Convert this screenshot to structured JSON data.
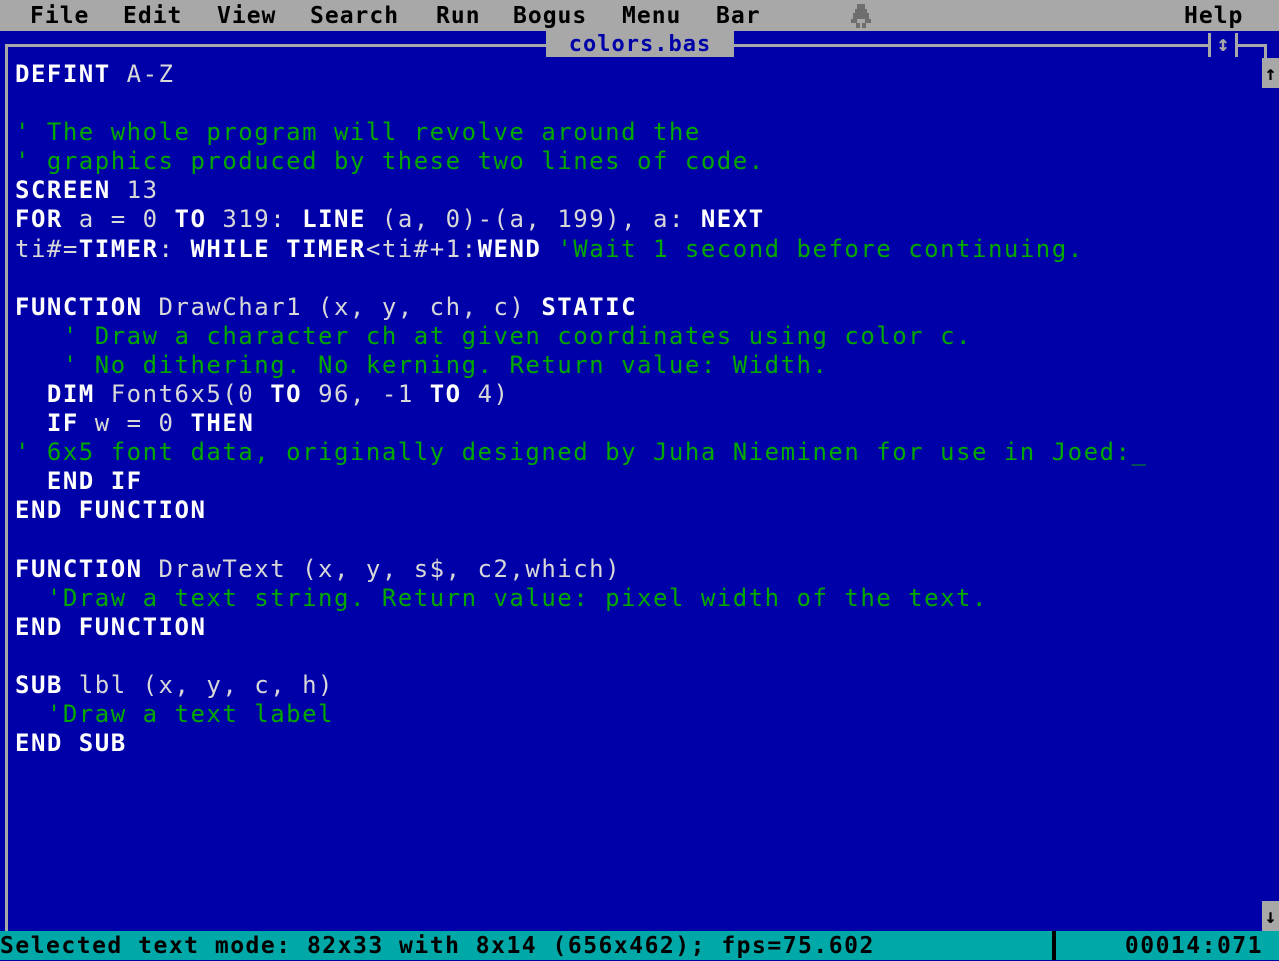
{
  "menubar": {
    "items": [
      "File",
      "Edit",
      "View",
      "Search",
      "Run",
      "Bogus",
      "Menu",
      "Bar"
    ],
    "help": "Help",
    "sprite_icon": "bug-sprite-icon"
  },
  "window": {
    "title": "colors.bas",
    "maximize_glyph": "↕"
  },
  "scrollbar": {
    "up_glyph": "↑",
    "down_glyph": "↓"
  },
  "code_lines": [
    [
      {
        "t": "kw",
        "s": "DEFINT"
      },
      {
        "t": "tx",
        "s": " A-Z"
      }
    ],
    [],
    [
      {
        "t": "cm",
        "s": "' The whole program will revolve around the"
      }
    ],
    [
      {
        "t": "cm",
        "s": "' graphics produced by these two lines of code."
      }
    ],
    [
      {
        "t": "kw",
        "s": "SCREEN"
      },
      {
        "t": "tx",
        "s": " 13"
      }
    ],
    [
      {
        "t": "kw",
        "s": "FOR"
      },
      {
        "t": "tx",
        "s": " a = 0 "
      },
      {
        "t": "kw",
        "s": "TO"
      },
      {
        "t": "tx",
        "s": " 319: "
      },
      {
        "t": "kw",
        "s": "LINE"
      },
      {
        "t": "tx",
        "s": " (a, 0)-(a, 199), a: "
      },
      {
        "t": "kw",
        "s": "NEXT"
      }
    ],
    [
      {
        "t": "tx",
        "s": "ti#="
      },
      {
        "t": "kw",
        "s": "TIMER"
      },
      {
        "t": "tx",
        "s": ": "
      },
      {
        "t": "kw",
        "s": "WHILE"
      },
      {
        "t": "tx",
        "s": " "
      },
      {
        "t": "kw",
        "s": "TIMER"
      },
      {
        "t": "tx",
        "s": "<ti#+1:"
      },
      {
        "t": "kw",
        "s": "WEND"
      },
      {
        "t": "tx",
        "s": " "
      },
      {
        "t": "cm",
        "s": "'Wait 1 second before continuing."
      }
    ],
    [],
    [
      {
        "t": "kw",
        "s": "FUNCTION"
      },
      {
        "t": "tx",
        "s": " DrawChar1 (x, y, ch, c) "
      },
      {
        "t": "kw",
        "s": "STATIC"
      }
    ],
    [
      {
        "t": "tx",
        "s": "   "
      },
      {
        "t": "cm",
        "s": "' Draw a character ch at given coordinates using color c."
      }
    ],
    [
      {
        "t": "tx",
        "s": "   "
      },
      {
        "t": "cm",
        "s": "' No dithering. No kerning. Return value: Width."
      }
    ],
    [
      {
        "t": "tx",
        "s": "  "
      },
      {
        "t": "kw",
        "s": "DIM"
      },
      {
        "t": "tx",
        "s": " Font6x5(0 "
      },
      {
        "t": "kw",
        "s": "TO"
      },
      {
        "t": "tx",
        "s": " 96, -1 "
      },
      {
        "t": "kw",
        "s": "TO"
      },
      {
        "t": "tx",
        "s": " 4)"
      }
    ],
    [
      {
        "t": "tx",
        "s": "  "
      },
      {
        "t": "kw",
        "s": "IF"
      },
      {
        "t": "tx",
        "s": " w = 0 "
      },
      {
        "t": "kw",
        "s": "THEN"
      }
    ],
    [
      {
        "t": "cm",
        "s": "' 6x5 font data, originally designed by Juha Nieminen for use in Joed:"
      },
      {
        "t": "cursor",
        "s": "_"
      }
    ],
    [
      {
        "t": "tx",
        "s": "  "
      },
      {
        "t": "kw",
        "s": "END IF"
      }
    ],
    [
      {
        "t": "kw",
        "s": "END FUNCTION"
      }
    ],
    [],
    [
      {
        "t": "kw",
        "s": "FUNCTION"
      },
      {
        "t": "tx",
        "s": " DrawText (x, y, s$, c2,which)"
      }
    ],
    [
      {
        "t": "tx",
        "s": "  "
      },
      {
        "t": "cm",
        "s": "'Draw a text string. Return value: pixel width of the text."
      }
    ],
    [
      {
        "t": "kw",
        "s": "END FUNCTION"
      }
    ],
    [],
    [
      {
        "t": "kw",
        "s": "SUB"
      },
      {
        "t": "tx",
        "s": " lbl (x, y, c, h)"
      }
    ],
    [
      {
        "t": "tx",
        "s": "  "
      },
      {
        "t": "cm",
        "s": "'Draw a text label"
      }
    ],
    [
      {
        "t": "kw",
        "s": "END SUB"
      }
    ]
  ],
  "status": {
    "text": "Selected text mode: 82x33 with 8x14 (656x462); fps=75.602",
    "position": "00014:071"
  },
  "colors": {
    "background": "#0000a8",
    "menubar": "#a8a8a8",
    "keyword": "#ffffff",
    "text": "#d8d8d8",
    "comment": "#00a800",
    "statusbar": "#00a8a8"
  }
}
